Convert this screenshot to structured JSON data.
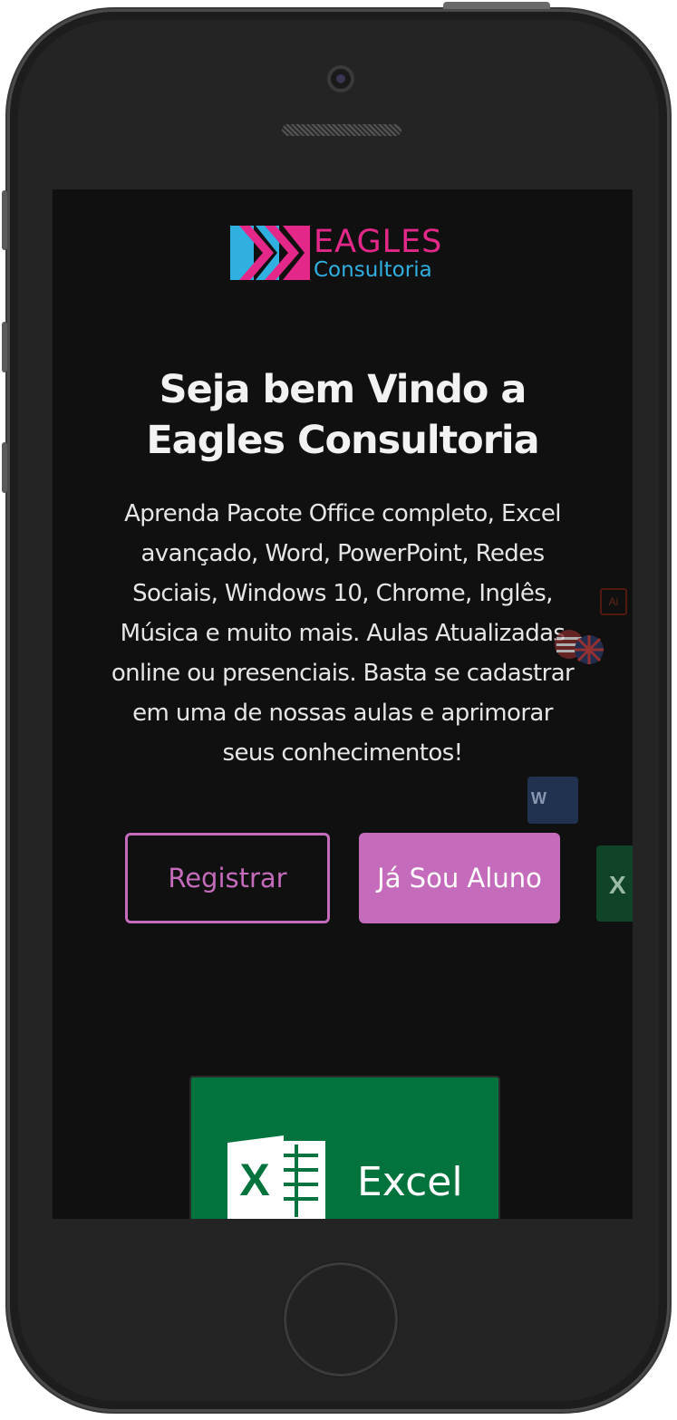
{
  "brand": {
    "name": "EAGLES",
    "sub": "Consultoria",
    "color_primary": "#e4288a",
    "color_secondary": "#2fb0e0"
  },
  "hero": {
    "title_line1": "Seja bem Vindo a",
    "title_line2": "Eagles Consultoria",
    "description": "Aprenda Pacote Office completo, Excel avançado, Word, PowerPoint, Redes Sociais, Windows 10, Chrome, Inglês, Música e muito mais. Aulas Atualizadas online ou presenciais. Basta se cadastrar em uma de nossas aulas e aprimorar seus conhecimentos!"
  },
  "buttons": {
    "register_label": "Registrar",
    "student_label": "Já Sou Aluno",
    "accent_color": "#c46bbb"
  },
  "floating_icons": {
    "ai_label": "Ai",
    "word_label": "W",
    "excel_label": "X"
  },
  "course_card": {
    "label": "Excel",
    "icon_letter": "X",
    "color": "#02733d"
  }
}
